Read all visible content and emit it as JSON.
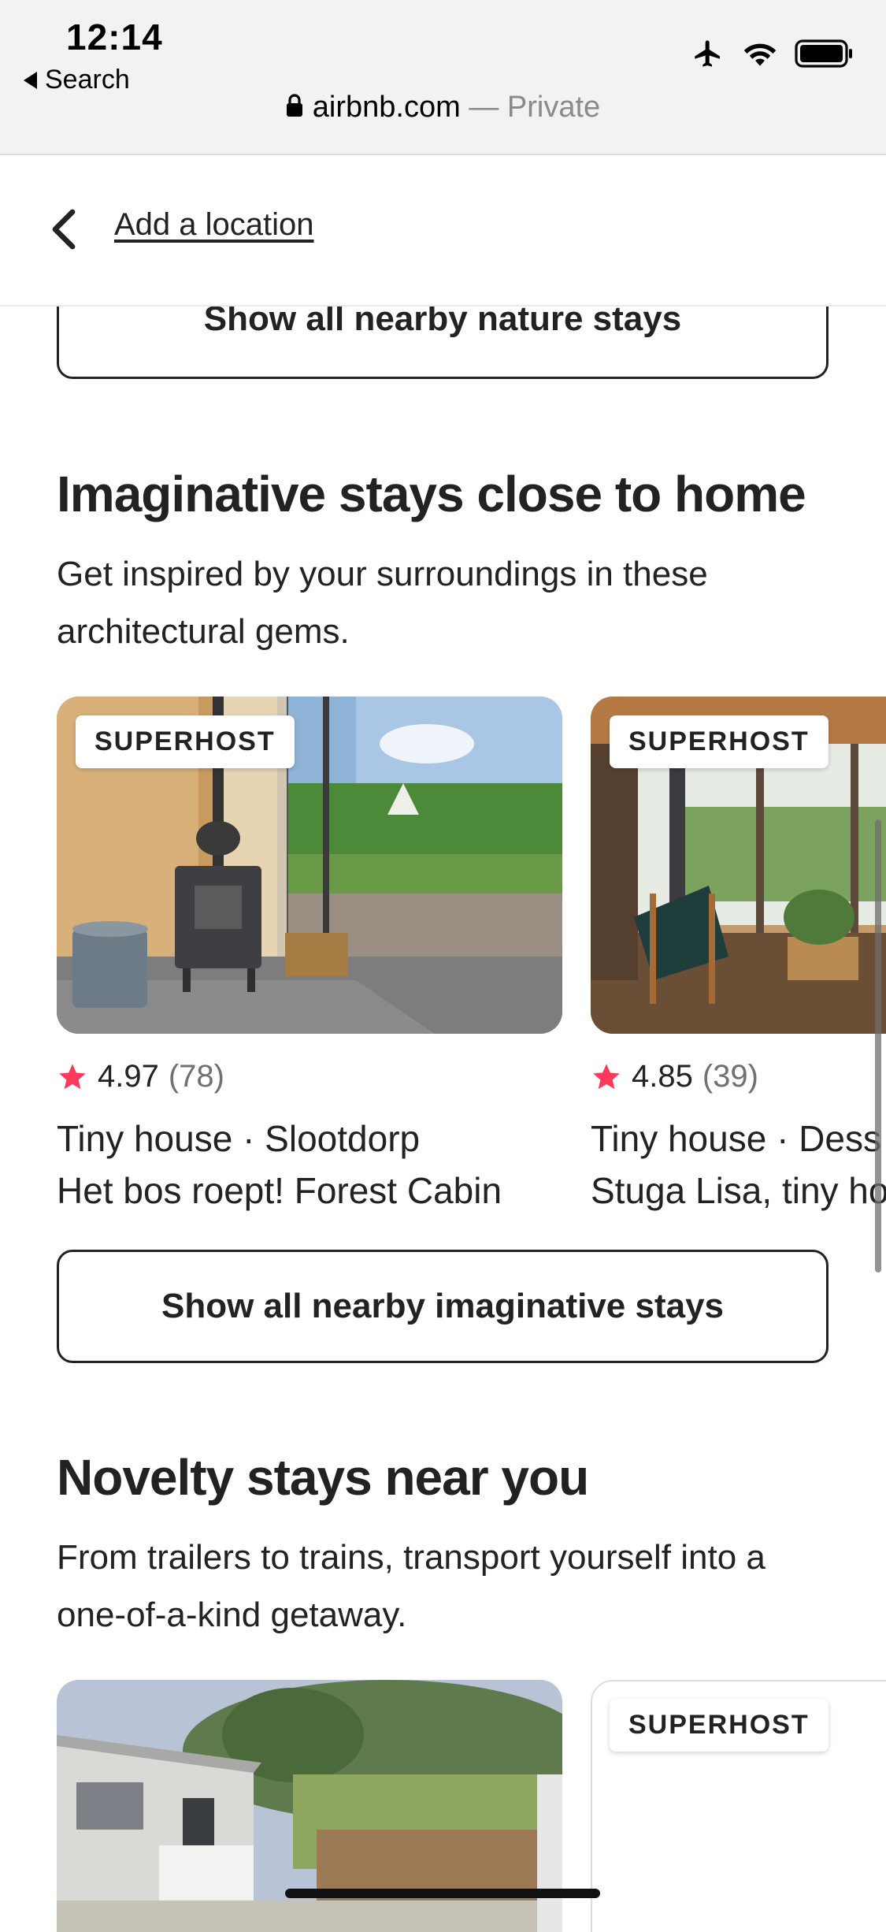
{
  "status_bar": {
    "time": "12:14",
    "back_label": "Search"
  },
  "browser": {
    "domain": "airbnb.com",
    "separator": "—",
    "mode": "Private"
  },
  "header": {
    "add_location": "Add a location"
  },
  "nature": {
    "button_label": "Show all nearby nature stays"
  },
  "imaginative": {
    "title": "Imaginative stays close to home",
    "subtitle": "Get inspired by your surroundings in these architectural gems.",
    "button_label": "Show all nearby imaginative stays",
    "cards": [
      {
        "badge": "SUPERHOST",
        "rating": "4.97",
        "reviews": "(78)",
        "type_line": "Tiny house · Slootdorp",
        "name": "Het bos roept! Forest Cabin"
      },
      {
        "badge": "SUPERHOST",
        "rating": "4.85",
        "reviews": "(39)",
        "type_line": "Tiny house · Dess",
        "name": "Stuga Lisa, tiny ho"
      }
    ]
  },
  "novelty": {
    "title": "Novelty stays near you",
    "subtitle": "From trailers to trains, transport yourself into a one-of-a-kind getaway.",
    "cards": [
      {
        "badge": "SUPERHOST"
      }
    ]
  },
  "colors": {
    "star": "#FF385C",
    "text": "#222222",
    "secondary_text": "#717171",
    "border": "#222222"
  }
}
